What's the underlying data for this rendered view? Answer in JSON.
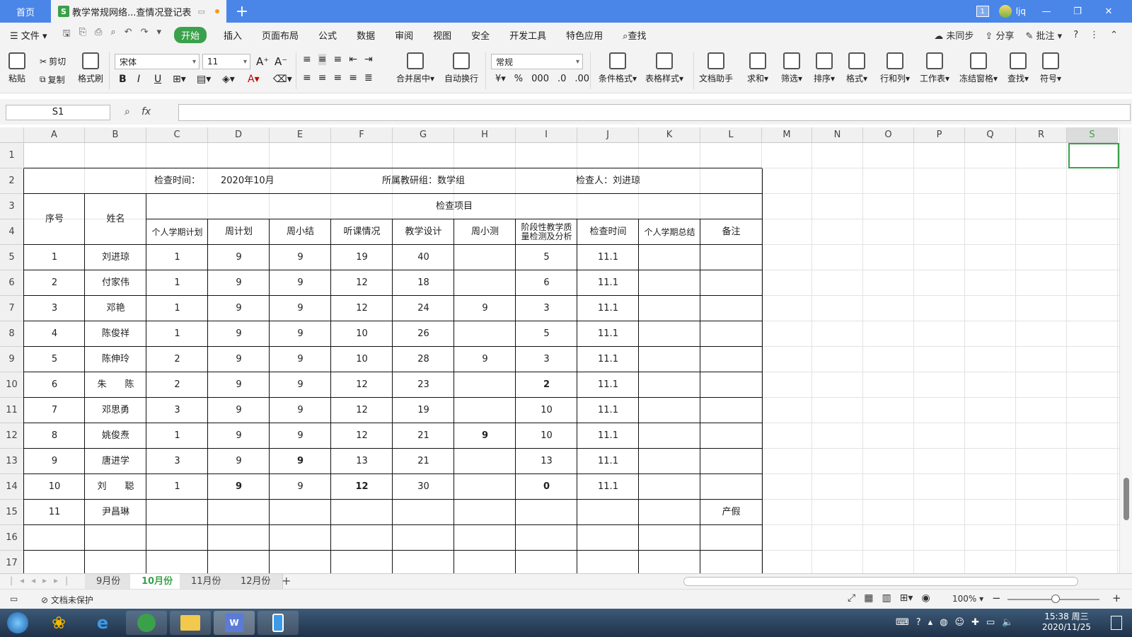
{
  "titlebar": {
    "home_tab": "首页",
    "doc_tab": "教学常规网络...查情况登记表",
    "doc_icon": "S",
    "badge": "1",
    "user": "ljq"
  },
  "menubar": {
    "file": "文件",
    "start": "开始",
    "items": [
      "插入",
      "页面布局",
      "公式",
      "数据",
      "审阅",
      "视图",
      "安全",
      "开发工具",
      "特色应用"
    ],
    "search": "查找",
    "right": [
      "未同步",
      "分享",
      "批注"
    ]
  },
  "ribbon": {
    "paste": "粘贴",
    "cut": "剪切",
    "copy": "复制",
    "format_painter": "格式刷",
    "font": "宋体",
    "size": "11",
    "number_format": "常规",
    "merge": "合并居中",
    "wrap": "自动换行",
    "cond_format": "条件格式",
    "table_style": "表格样式",
    "doc_helper": "文档助手",
    "sum": "求和",
    "filter": "筛选",
    "sort": "排序",
    "format": "格式",
    "rowcol": "行和列",
    "sheet": "工作表",
    "freeze": "冻结窗格",
    "find": "查找",
    "symbol": "符号"
  },
  "formula": {
    "namebox": "S1",
    "fx": "fx"
  },
  "columns": [
    "A",
    "B",
    "C",
    "D",
    "E",
    "F",
    "G",
    "H",
    "I",
    "J",
    "K",
    "L",
    "M",
    "N",
    "O",
    "P",
    "Q",
    "R",
    "S"
  ],
  "rows": [
    "1",
    "2",
    "3",
    "4",
    "5",
    "6",
    "7",
    "8",
    "9",
    "10",
    "11",
    "12",
    "13",
    "14",
    "15",
    "16",
    "17"
  ],
  "sheet": {
    "check_time_label": "检查时间：",
    "check_time_value": "2020年10月",
    "group": "所属教研组：数学组",
    "inspector": "检查人：刘进琼",
    "h_no": "序号",
    "h_name": "姓名",
    "h_items": "检查项目",
    "sub_headers": [
      "个人学期计划",
      "周计划",
      "周小结",
      "听课情况",
      "教学设计",
      "周小测",
      "阶段性教学质量检测及分析",
      "检查时间",
      "个人学期总结",
      "备注"
    ],
    "records": [
      [
        "1",
        "刘进琼",
        "1",
        "9",
        "9",
        "19",
        "40",
        "",
        "5",
        "11.1",
        "",
        ""
      ],
      [
        "2",
        "付家伟",
        "1",
        "9",
        "9",
        "12",
        "18",
        "",
        "6",
        "11.1",
        "",
        ""
      ],
      [
        "3",
        "邓艳",
        "1",
        "9",
        "9",
        "12",
        "24",
        "9",
        "3",
        "11.1",
        "",
        ""
      ],
      [
        "4",
        "陈俊祥",
        "1",
        "9",
        "9",
        "10",
        "26",
        "",
        "5",
        "11.1",
        "",
        ""
      ],
      [
        "5",
        "陈伸玲",
        "2",
        "9",
        "9",
        "10",
        "28",
        "9",
        "3",
        "11.1",
        "",
        ""
      ],
      [
        "6",
        "朱　　陈",
        "2",
        "9",
        "9",
        "12",
        "23",
        "",
        "2",
        "11.1",
        "",
        ""
      ],
      [
        "7",
        "邓思勇",
        "3",
        "9",
        "9",
        "12",
        "19",
        "",
        "10",
        "11.1",
        "",
        ""
      ],
      [
        "8",
        "姚俊焘",
        "1",
        "9",
        "9",
        "12",
        "21",
        "9",
        "10",
        "11.1",
        "",
        ""
      ],
      [
        "9",
        "唐进学",
        "3",
        "9",
        "9",
        "13",
        "21",
        "",
        "13",
        "11.1",
        "",
        ""
      ],
      [
        "10",
        "刘　　聪",
        "1",
        "9",
        "9",
        "12",
        "30",
        "",
        "0",
        "11.1",
        "",
        ""
      ],
      [
        "11",
        "尹昌琳",
        "",
        "",
        "",
        "",
        "",
        "",
        "",
        "",
        "",
        "产假"
      ]
    ]
  },
  "sheet_tabs": [
    "9月份",
    "10月份",
    "11月份",
    "12月份"
  ],
  "active_tab": "10月份",
  "status": {
    "protect": "文档未保护",
    "zoom": "100%"
  },
  "clock": {
    "time": "15:38 周三",
    "date": "2020/11/25"
  }
}
